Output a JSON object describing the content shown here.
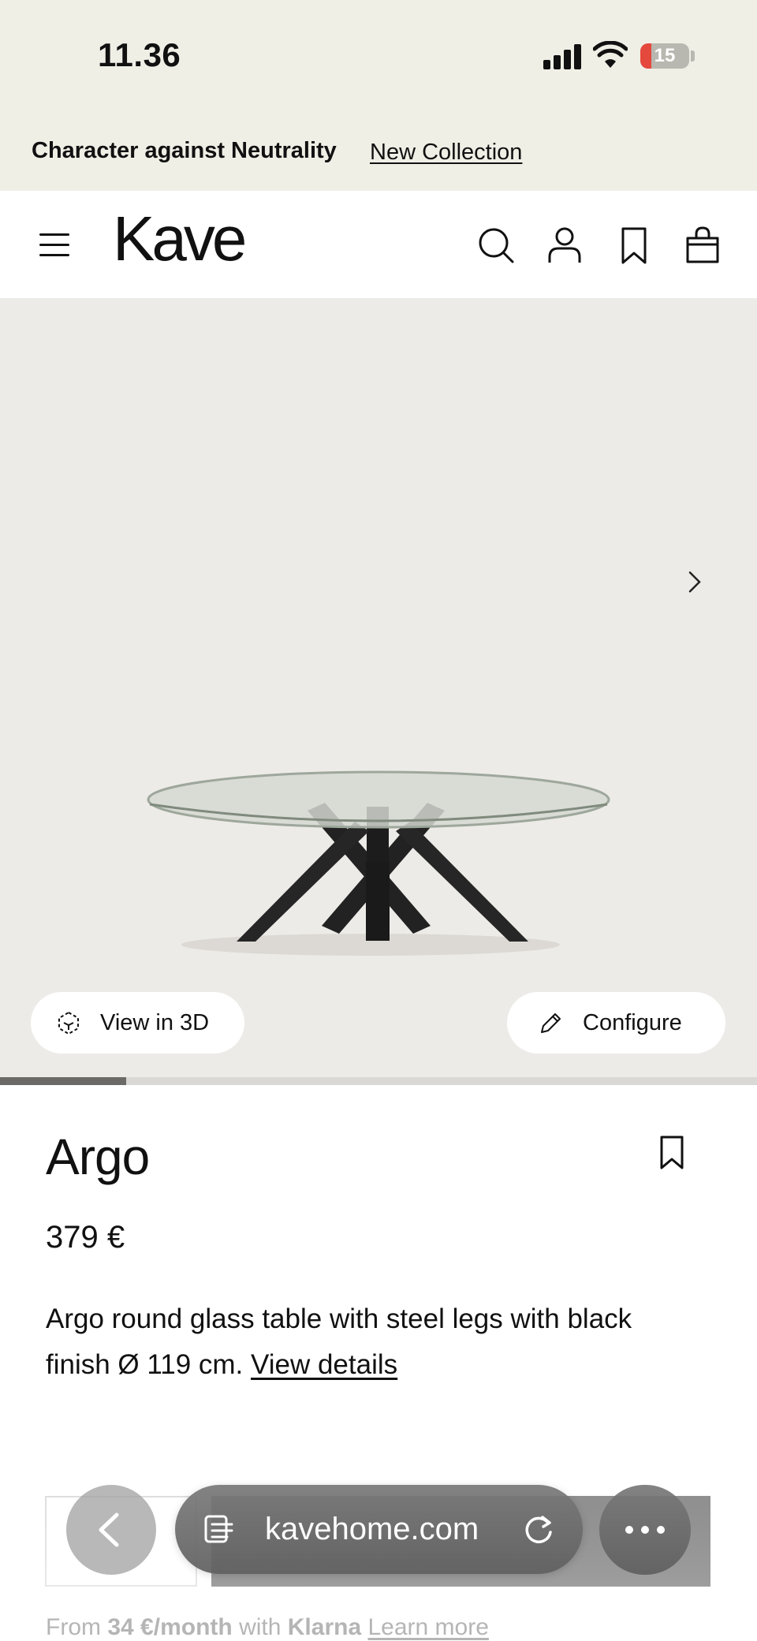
{
  "status_bar": {
    "time": "11.36",
    "battery": "15"
  },
  "promo": {
    "text": "Character against Neutrality",
    "link": "New Collection"
  },
  "header": {
    "logo": "Kave"
  },
  "gallery": {
    "view_3d_label": "View in 3D",
    "configure_label": "Configure",
    "progress": 0.167
  },
  "product": {
    "name": "Argo",
    "price": "379 €",
    "description": "Argo round glass table with steel legs with black finish Ø 119 cm.",
    "details_link": "View details"
  },
  "financing": {
    "prefix": "From",
    "amount": "34 €/month",
    "middle": "with",
    "provider": "Klarna",
    "link": "Learn more"
  },
  "browser": {
    "url": "kavehome.com"
  },
  "icons": {
    "menu": "hamburger-icon",
    "search": "search-icon",
    "account": "user-icon",
    "wishlist": "bookmark-icon",
    "cart": "shopping-bag-icon"
  },
  "colors": {
    "promo_bg": "#f0efe6",
    "gallery_bg": "#edebe7",
    "text": "#111111"
  }
}
